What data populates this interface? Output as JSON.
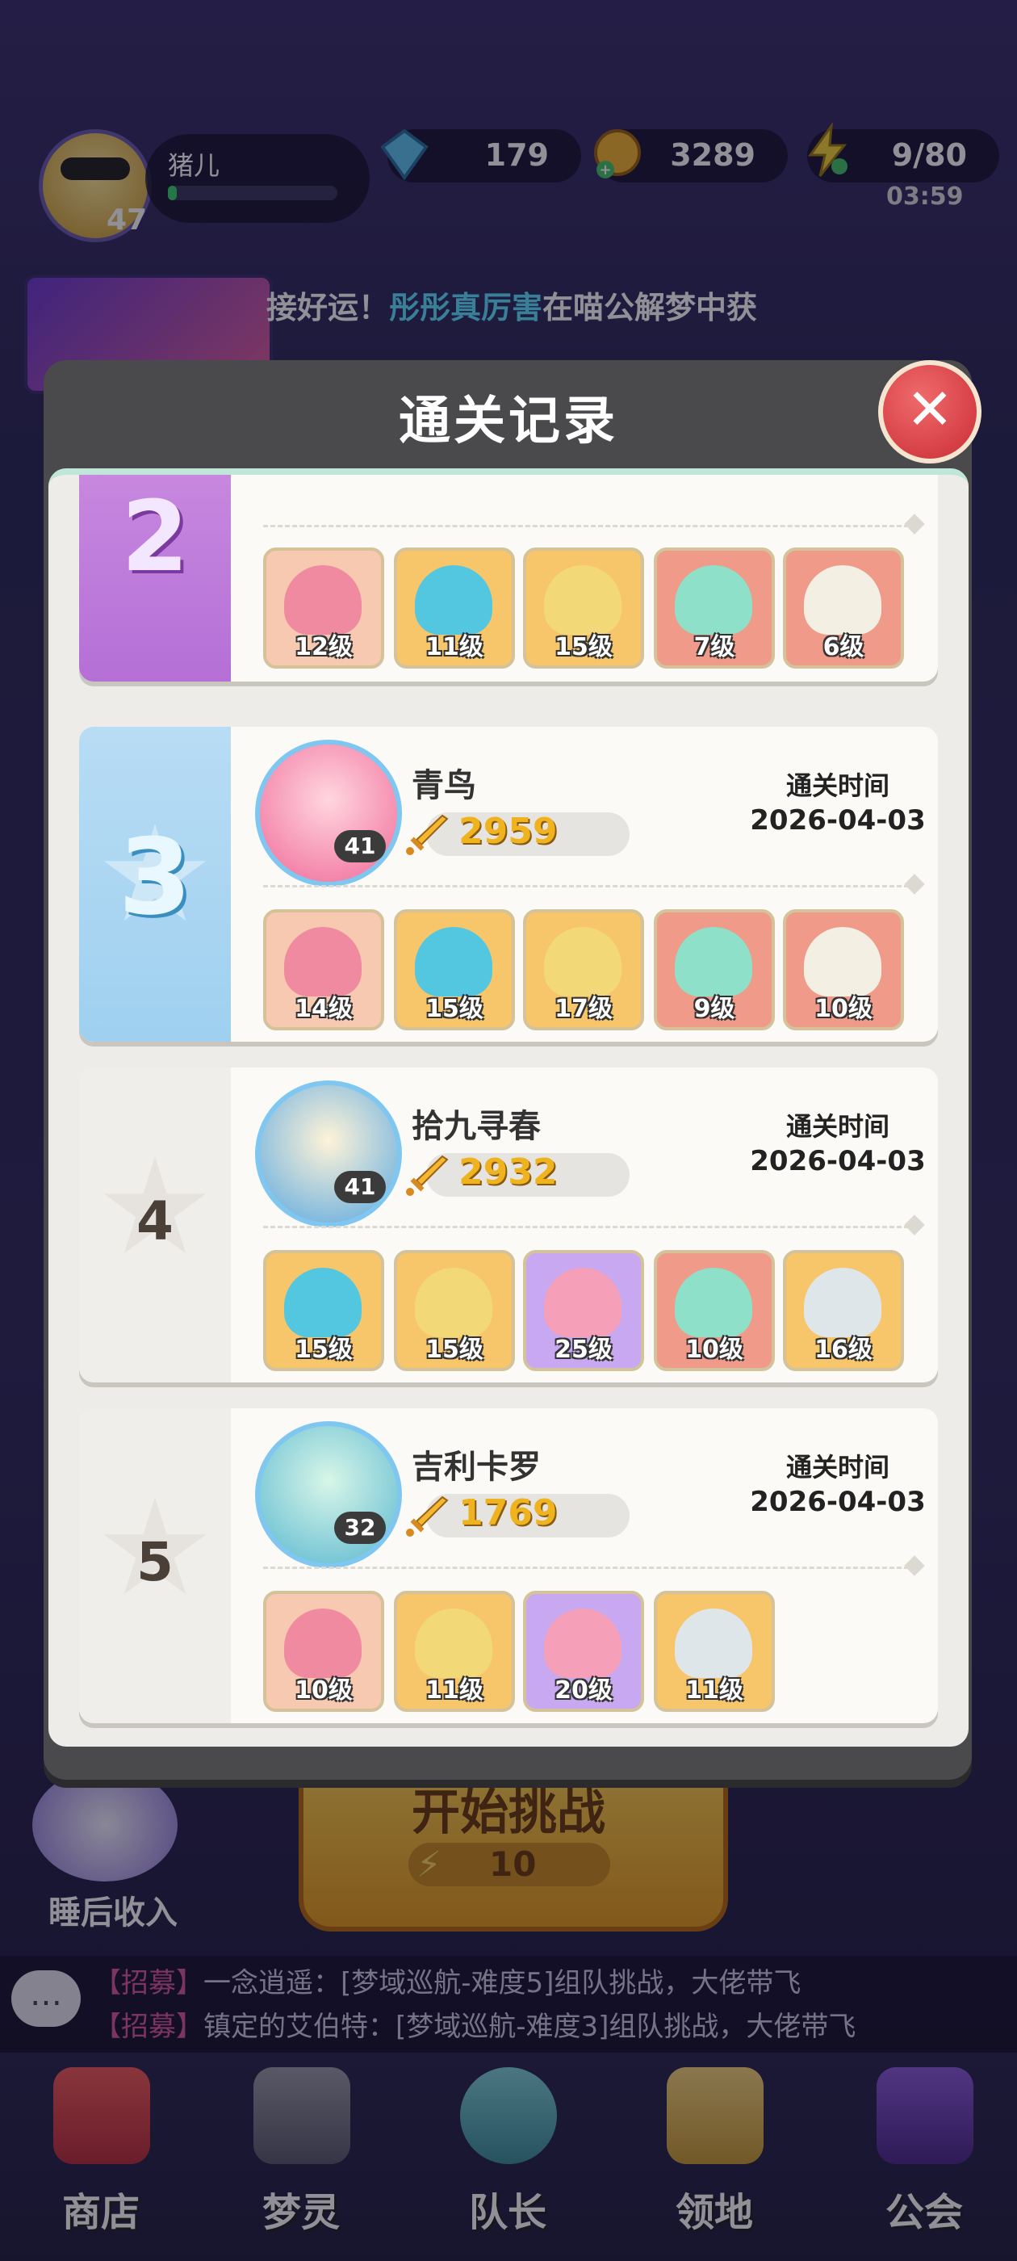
{
  "player": {
    "name": "猪儿",
    "level": "47",
    "exp_fraction": 0.05
  },
  "resources": {
    "gems": "179",
    "coins": "3289",
    "energy": "9/80",
    "energy_timer": "03:59"
  },
  "news": {
    "prefix": "接好运！",
    "highlight": "彤彤真厉害",
    "suffix": "在喵公解梦中获"
  },
  "panel": {
    "title": "通关记录",
    "time_label": "通关时间"
  },
  "records": [
    {
      "rank": "2",
      "heroes": [
        "12级",
        "11级",
        "15级",
        "7级",
        "6级"
      ]
    },
    {
      "rank": "3",
      "name": "青鸟",
      "level": "41",
      "power": "2959",
      "date": "2026-04-03",
      "heroes": [
        "14级",
        "15级",
        "17级",
        "9级",
        "10级"
      ]
    },
    {
      "rank": "4",
      "name": "拾九寻春",
      "level": "41",
      "power": "2932",
      "date": "2026-04-03",
      "heroes": [
        "15级",
        "15级",
        "25级",
        "10级",
        "16级"
      ]
    },
    {
      "rank": "5",
      "name": "吉利卡罗",
      "level": "32",
      "power": "1769",
      "date": "2026-04-03",
      "heroes": [
        "10级",
        "11级",
        "20级",
        "11级"
      ]
    }
  ],
  "start": {
    "label": "开始挑战",
    "cost": "10"
  },
  "sleep_income": "睡后收入",
  "chat": [
    {
      "tag": "【招募】",
      "text": "一念逍遥：[梦域巡航-难度5]组队挑战，大佬带飞"
    },
    {
      "tag": "【招募】",
      "text": "镇定的艾伯特：[梦域巡航-难度3]组队挑战，大佬带飞"
    }
  ],
  "nav": [
    "商店",
    "梦灵",
    "队长",
    "领地",
    "公会"
  ],
  "colors": {
    "accent_yellow": "#f0b320",
    "rank2": "#c98be0",
    "rank3": "#a9d6f2",
    "close_red": "#d8343e"
  }
}
